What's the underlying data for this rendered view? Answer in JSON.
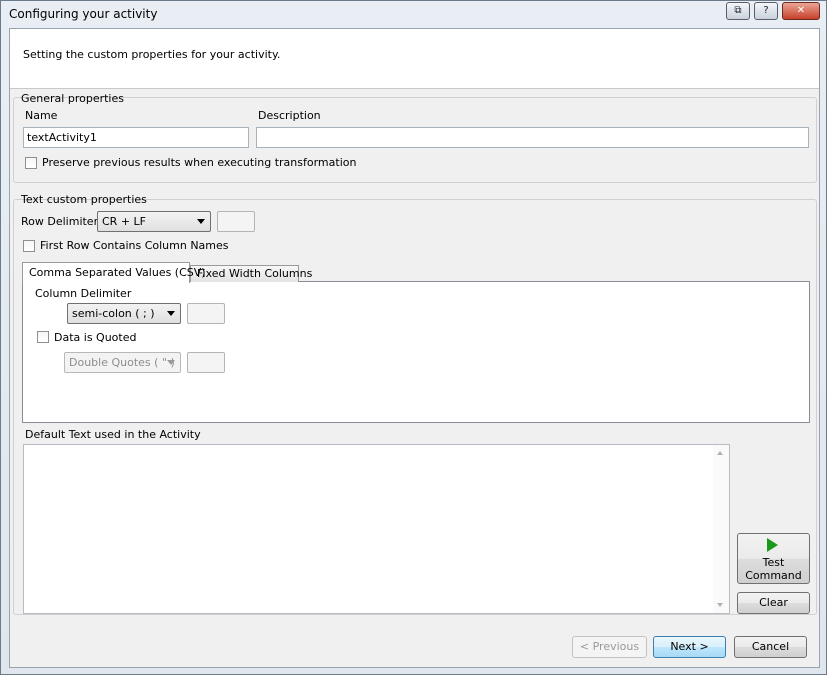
{
  "window": {
    "title": "Configuring your activity"
  },
  "titlebar_buttons": [
    "⧉",
    "?",
    "✕"
  ],
  "header": {
    "text": "Setting the custom properties for your activity."
  },
  "general": {
    "group_label": "General properties",
    "name_label": "Name",
    "name_value": "textActivity1",
    "description_label": "Description",
    "description_value": "",
    "preserve_label": "Preserve previous results when executing transformation"
  },
  "text_props": {
    "group_label": "Text custom properties",
    "row_delim_label": "Row Delimiter",
    "row_delim_value": "CR + LF",
    "first_row_label": "First Row Contains Column Names"
  },
  "tabs": [
    {
      "label": "Comma Separated Values (CSV)",
      "active": true
    },
    {
      "label": "Fixed Width Columns",
      "active": false
    }
  ],
  "csv": {
    "col_delim_label": "Column Delimiter",
    "col_delim_value": "semi-colon ( ; )",
    "quoted_label": "Data is Quoted",
    "quote_value": "Double Quotes ( \" )"
  },
  "default_text": {
    "label": "Default Text used in the Activity",
    "value": ""
  },
  "buttons": {
    "test_line1": "Test",
    "test_line2": "Command",
    "clear": "Clear",
    "previous": "< Previous",
    "next": "Next >",
    "cancel": "Cancel"
  }
}
